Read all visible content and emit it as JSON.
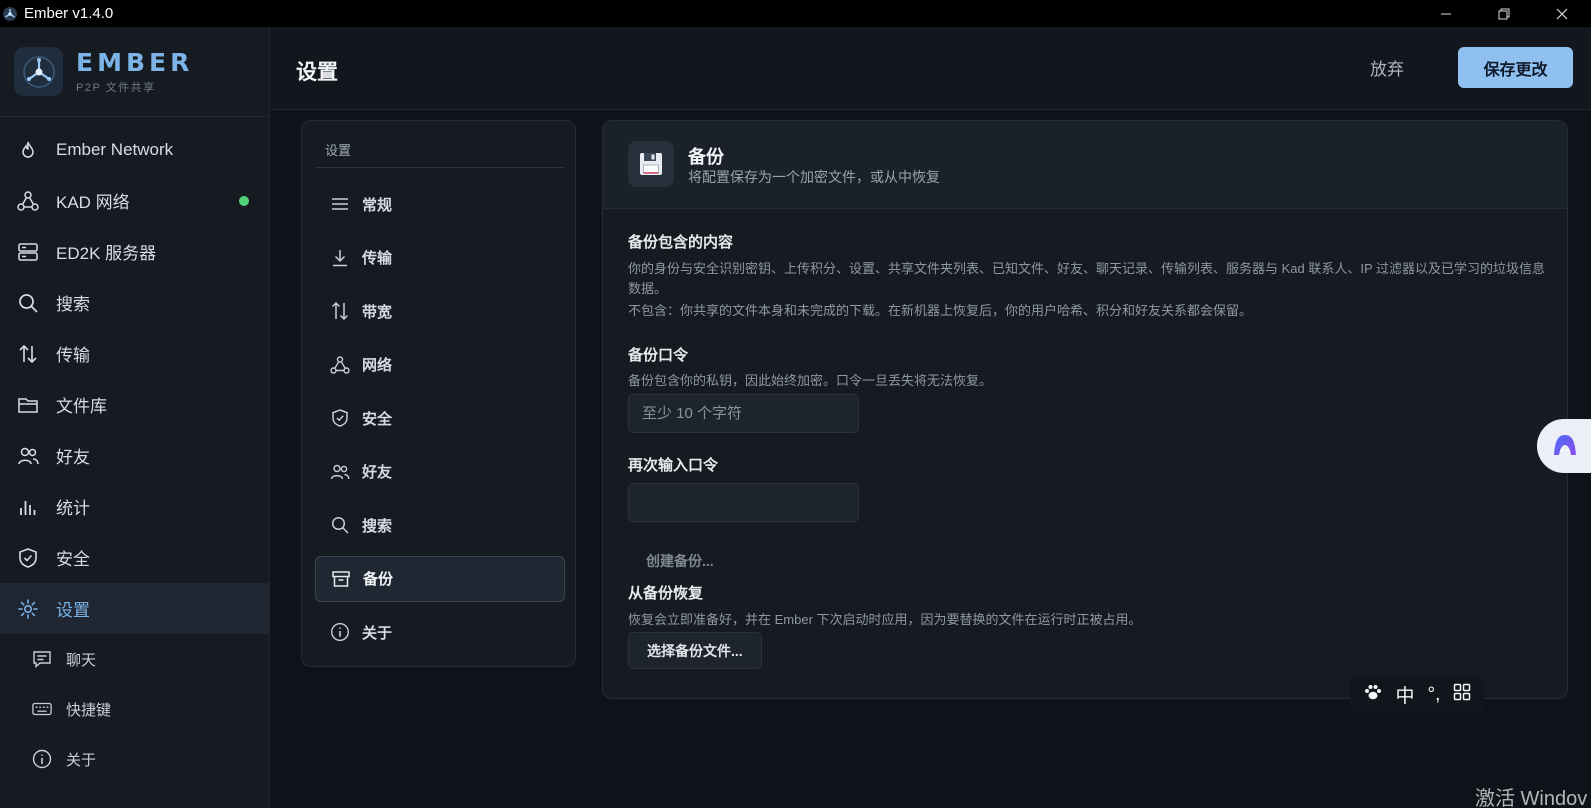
{
  "window": {
    "title": "Ember v1.4.0"
  },
  "brand": {
    "name": "EMBER",
    "subtitle": "P2P 文件共享"
  },
  "sidebar": {
    "items": [
      {
        "label": "Ember Network",
        "icon": "flame-icon"
      },
      {
        "label": "KAD 网络",
        "icon": "network-nodes-icon",
        "status": "online",
        "status_color": "#4fd27a"
      },
      {
        "label": "ED2K 服务器",
        "icon": "server-icon"
      },
      {
        "label": "搜索",
        "icon": "search-icon"
      },
      {
        "label": "传输",
        "icon": "transfer-arrows-icon"
      },
      {
        "label": "文件库",
        "icon": "folder-icon"
      },
      {
        "label": "好友",
        "icon": "friends-icon"
      },
      {
        "label": "统计",
        "icon": "bar-chart-icon"
      },
      {
        "label": "安全",
        "icon": "shield-check-icon"
      },
      {
        "label": "设置",
        "icon": "gear-icon",
        "active": true
      }
    ],
    "sub_items": [
      {
        "label": "聊天",
        "icon": "chat-icon"
      },
      {
        "label": "快捷键",
        "icon": "keyboard-icon"
      },
      {
        "label": "关于",
        "icon": "info-icon"
      }
    ]
  },
  "header": {
    "title": "设置",
    "discard_label": "放弃",
    "save_label": "保存更改"
  },
  "settings_nav": {
    "title": "设置",
    "items": [
      {
        "label": "常规",
        "icon": "menu-lines-icon"
      },
      {
        "label": "传输",
        "icon": "download-icon"
      },
      {
        "label": "带宽",
        "icon": "transfer-arrows-icon"
      },
      {
        "label": "网络",
        "icon": "network-nodes-icon"
      },
      {
        "label": "安全",
        "icon": "shield-check-icon"
      },
      {
        "label": "好友",
        "icon": "friends-icon"
      },
      {
        "label": "搜索",
        "icon": "search-icon"
      },
      {
        "label": "备份",
        "icon": "archive-icon",
        "active": true
      },
      {
        "label": "关于",
        "icon": "info-icon"
      }
    ]
  },
  "backup": {
    "title": "备份",
    "description": "将配置保存为一个加密文件，或从中恢复",
    "contents_title": "备份包含的内容",
    "contents_text": "你的身份与安全识别密钥、上传积分、设置、共享文件夹列表、已知文件、好友、聊天记录、传输列表、服务器与 Kad 联系人、IP 过滤器以及已学习的垃圾信息数据。",
    "excludes_text": "不包含：你共享的文件本身和未完成的下载。在新机器上恢复后，你的用户哈希、积分和好友关系都会保留。",
    "passphrase_title": "备份口令",
    "passphrase_hint": "备份包含你的私钥，因此始终加密。口令一旦丢失将无法恢复。",
    "passphrase_placeholder": "至少 10 个字符",
    "passphrase_value": "",
    "confirm_title": "再次输入口令",
    "confirm_value": "",
    "create_label": "创建备份...",
    "restore_title": "从备份恢复",
    "restore_text": "恢复会立即准备好，并在 Ember 下次启动时应用，因为要替换的文件在运行时正被占用。",
    "choose_file_label": "选择备份文件..."
  },
  "ime": {
    "mode": "中",
    "punct": "°,"
  },
  "watermark": {
    "text": "激活 Windov"
  },
  "colors": {
    "accent": "#7cb4e8",
    "save_button": "#8fc0f0",
    "online": "#4fd27a"
  }
}
